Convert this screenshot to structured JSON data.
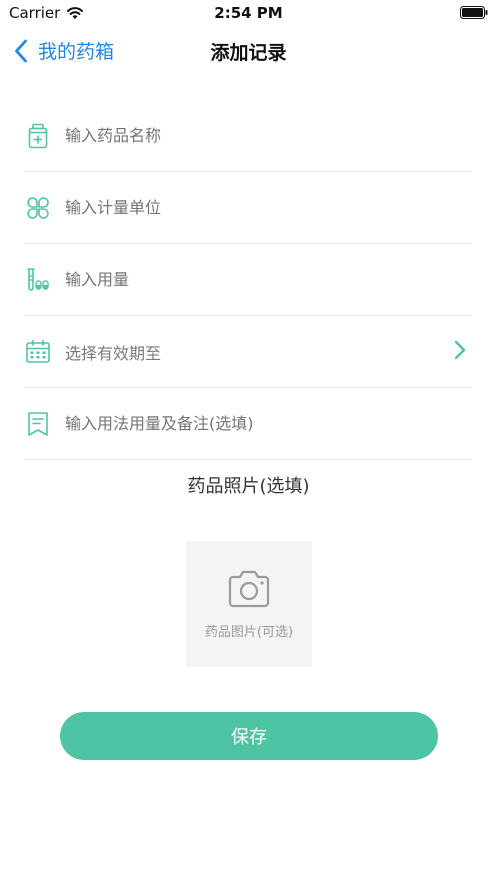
{
  "statusbar": {
    "carrier": "Carrier",
    "time": "2:54 PM"
  },
  "nav": {
    "back_label": "我的药箱",
    "title": "添加记录"
  },
  "form": {
    "name_placeholder": "输入药品名称",
    "unit_placeholder": "输入计量单位",
    "dosage_placeholder": "输入用量",
    "expiry_label": "选择有效期至",
    "notes_placeholder": "输入用法用量及备注(选填)"
  },
  "photo": {
    "title": "药品照片(选填)",
    "box_label": "药品图片(可选)"
  },
  "save_label": "保存",
  "colors": {
    "accent": "#4fc4a4",
    "link": "#1e88e5",
    "placeholder": "#b3b3b3"
  }
}
